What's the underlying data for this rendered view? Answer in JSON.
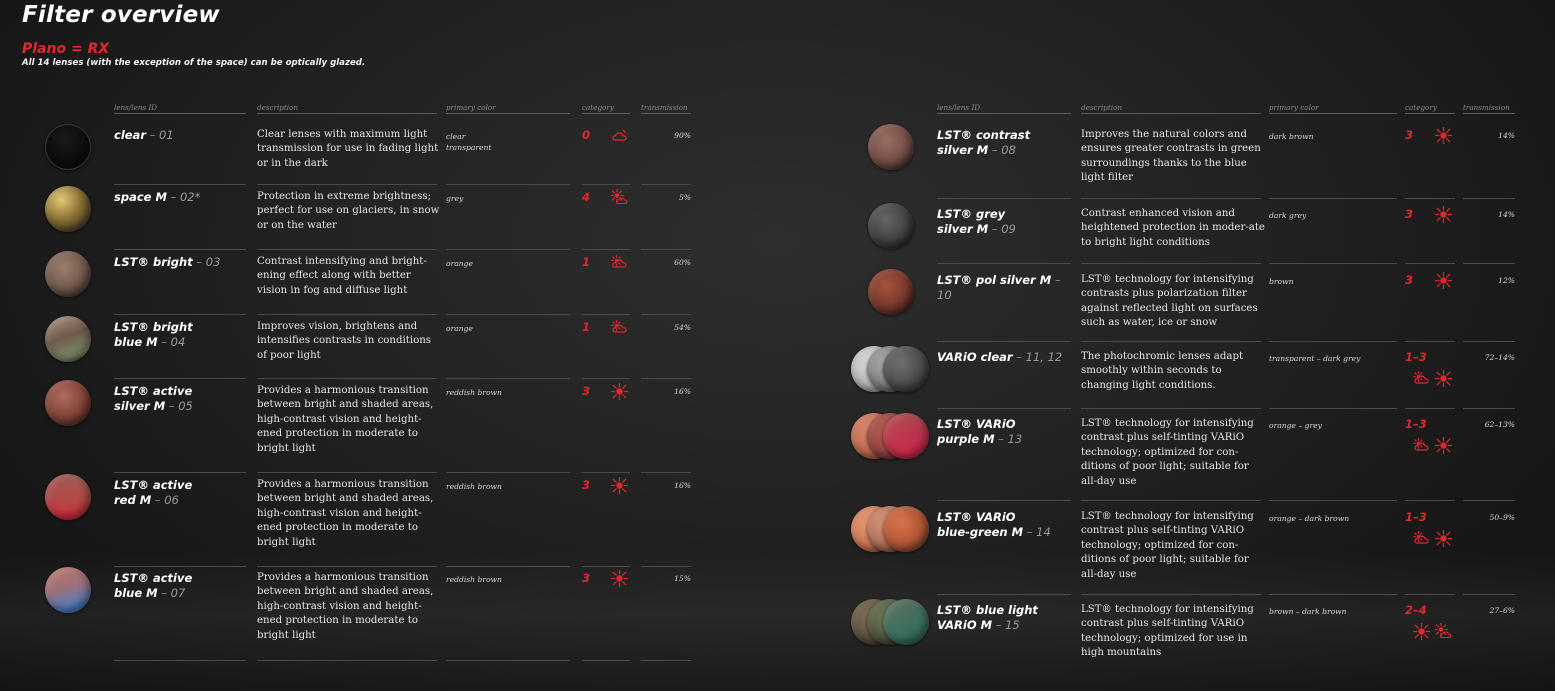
{
  "title": "Filter overview",
  "subtitle": "Plano = RX",
  "note": "All 14 lenses (with the exception of the space) can be optically glazed.",
  "headers": {
    "lens": "lens/lens ID",
    "description": "description",
    "primary_color": "primary color",
    "category": "category",
    "transmission": "transmission"
  },
  "colors": {
    "accent": "#e0262f"
  },
  "left": [
    {
      "name": "clear",
      "id": "– 01",
      "description": "Clear lenses with maximum light transmission for use in fading light or in the dark",
      "primary_color": "clear\ntransparent",
      "category": "0",
      "icons": [
        "cloud-moon-icon"
      ],
      "transmission": "90%"
    },
    {
      "name": "space M",
      "id": "– 02*",
      "description": "Protection in extreme brightness; perfect for use on glaciers, in snow or on the water",
      "primary_color": "grey",
      "category": "4",
      "icons": [
        "sun-cloud-icon"
      ],
      "transmission": "5%"
    },
    {
      "name": "LST® bright",
      "id": "– 03",
      "description": "Contrast intensifying and bright-ening effect along with better vision in fog and diffuse light",
      "primary_color": "orange",
      "category": "1",
      "icons": [
        "cloud-sun-icon"
      ],
      "transmission": "60%"
    },
    {
      "name": "LST® bright\nblue M",
      "id": "– 04",
      "description": "Improves vision, brightens and intensifies contrasts in conditions of poor light",
      "primary_color": "orange",
      "category": "1",
      "icons": [
        "cloud-sun-icon"
      ],
      "transmission": "54%"
    },
    {
      "name": "LST® active\nsilver M",
      "id": "– 05",
      "description": "Provides a harmonious transition between bright and shaded areas, high-contrast vision and height-ened protection in moderate to bright light",
      "primary_color": "reddish brown",
      "category": "3",
      "icons": [
        "sun-icon"
      ],
      "transmission": "16%"
    },
    {
      "name": "LST® active\nred M",
      "id": "– 06",
      "description": "Provides a harmonious transition between bright and shaded areas, high-contrast vision and height-ened protection in moderate to bright light",
      "primary_color": "reddish brown",
      "category": "3",
      "icons": [
        "sun-icon"
      ],
      "transmission": "16%"
    },
    {
      "name": "LST® active\nblue M",
      "id": "– 07",
      "description": "Provides a harmonious transition between bright and shaded areas, high-contrast vision and height-ened protection in moderate to bright light",
      "primary_color": "reddish brown",
      "category": "3",
      "icons": [
        "sun-icon"
      ],
      "transmission": "15%"
    }
  ],
  "right": [
    {
      "name": "LST® contrast\nsilver M",
      "id": "– 08",
      "description": "Improves the natural colors and ensures greater contrasts in green surroundings thanks to the blue light filter",
      "primary_color": "dark brown",
      "category": "3",
      "icons": [
        "sun-icon"
      ],
      "transmission": "14%"
    },
    {
      "name": "LST® grey\nsilver M",
      "id": "– 09",
      "description": "Contrast enhanced vision and heightened protection in moder-ate to bright light conditions",
      "primary_color": "dark grey",
      "category": "3",
      "icons": [
        "sun-icon"
      ],
      "transmission": "14%"
    },
    {
      "name": "LST® pol silver M",
      "id": "– 10",
      "description": "LST® technology for intensifying contrasts plus polarization filter against reflected light on surfaces such as water, ice or snow",
      "primary_color": "brown",
      "category": "3",
      "icons": [
        "sun-icon"
      ],
      "transmission": "12%"
    },
    {
      "name": "VARiO clear",
      "id": "– 11, 12",
      "description": "The photochromic lenses adapt smoothly within seconds to changing light conditions.",
      "primary_color": "transparent – dark grey",
      "category": "1–3",
      "icons": [
        "cloud-sun-icon",
        "sun-icon"
      ],
      "transmission": "72–14%"
    },
    {
      "name": "LST® VARiO\npurple M",
      "id": "– 13",
      "description": "LST® technology for intensifying contrast plus self-tinting VARiO technology; optimized for con-ditions of poor light; suitable for all-day use",
      "primary_color": "orange – grey",
      "category": "1–3",
      "icons": [
        "cloud-sun-icon",
        "sun-icon"
      ],
      "transmission": "62–13%"
    },
    {
      "name": "LST® VARiO\nblue-green M",
      "id": "– 14",
      "description": "LST® technology for intensifying contrast plus self-tinting VARiO technology; optimized for con-ditions of poor light; suitable for all-day use",
      "primary_color": "orange – dark brown",
      "category": "1–3",
      "icons": [
        "cloud-sun-icon",
        "sun-icon"
      ],
      "transmission": "50–9%"
    },
    {
      "name": "LST® blue light\nVARiO M",
      "id": "– 15",
      "description": "LST® technology for intensifying contrast plus self-tinting VARiO technology; optimized for use in high mountains",
      "primary_color": "brown – dark brown",
      "category": "2–4",
      "icons": [
        "sun-icon",
        "sun-cloud-icon"
      ],
      "transmission": "27–6%"
    }
  ]
}
